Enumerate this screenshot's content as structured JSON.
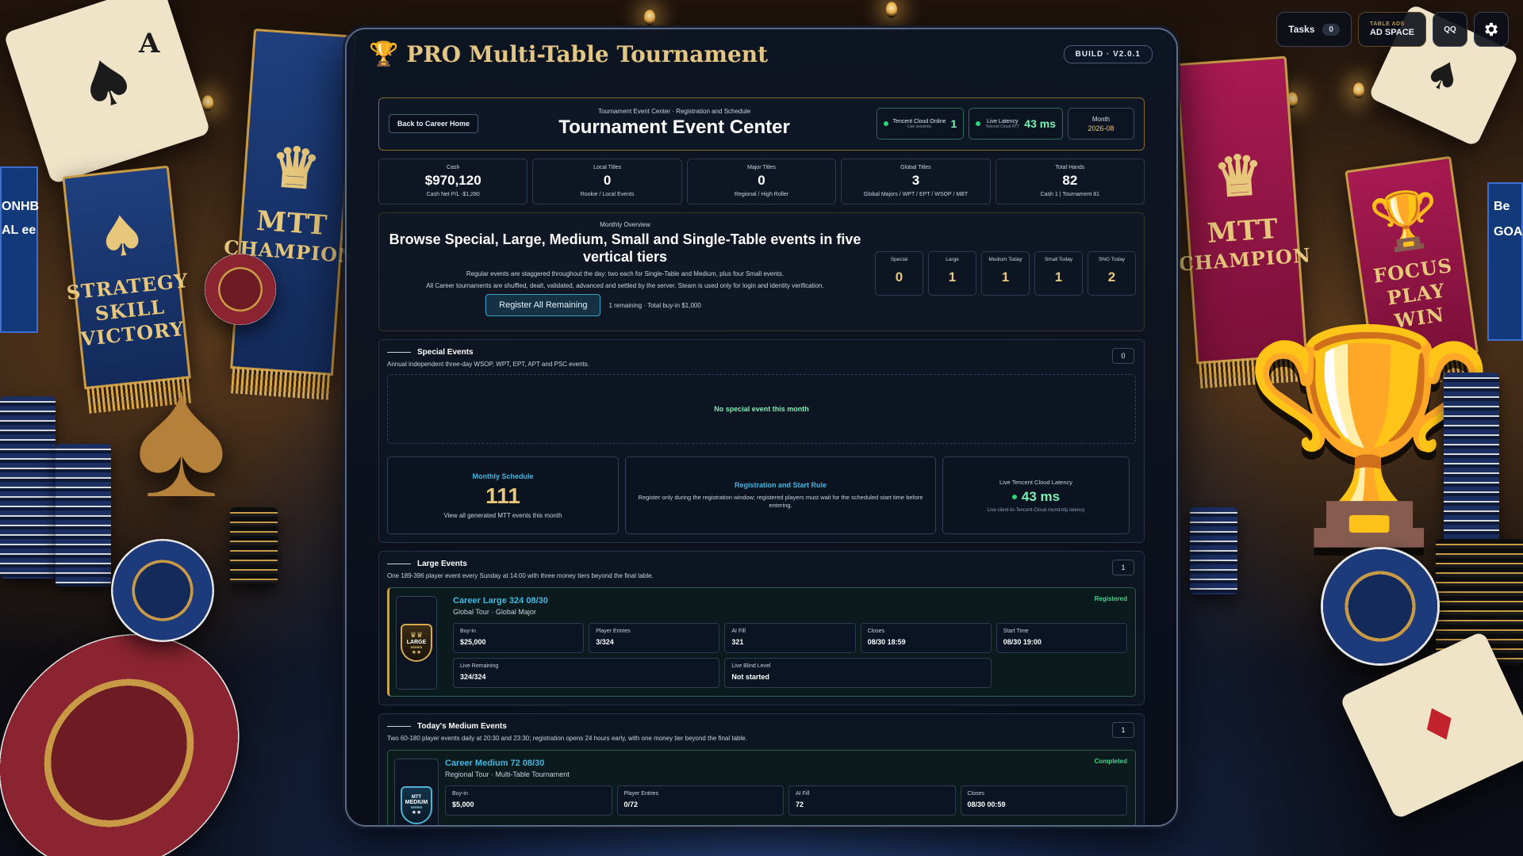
{
  "app": {
    "title": "PRO Multi-Table Tournament",
    "build": "BUILD · V2.0.1"
  },
  "topbar": {
    "tasks_label": "Tasks",
    "tasks_count": "0",
    "ads_small": "TABLE ADS",
    "ads_big": "AD SPACE",
    "qq_label": "QQ",
    "settings_icon": "gear-icon"
  },
  "backdrop": {
    "banner_left_1": [
      "STRATEGY",
      "SKILL",
      "VICTORY"
    ],
    "banner_left_2": [
      "MTT",
      "CHAMPION"
    ],
    "banner_right_1": [
      "MTT",
      "CHAMPION"
    ],
    "banner_right_2": [
      "FOCUS",
      "PLAY",
      "WIN"
    ],
    "card_left": "A",
    "far_left_sign": [
      "ONHB",
      "AL ee"
    ],
    "far_right_sign": [
      "Be",
      "GOA"
    ]
  },
  "header": {
    "back_label": "Back to Career Home",
    "kicker": "Tournament Event Center · Registration and Schedule",
    "title": "Tournament Event Center",
    "cloud_label": "Tencent Cloud Online",
    "cloud_sub": "Live sessions",
    "cloud_value": "1",
    "latency_label": "Live Latency",
    "latency_sub": "Tencent Cloud RTT",
    "latency_value": "43 ms",
    "month_label": "Month",
    "month_value": "2026-08"
  },
  "stats": [
    {
      "label": "Cash",
      "value": "$970,120",
      "sub": "Cash Net P/L -$1,280"
    },
    {
      "label": "Local Titles",
      "value": "0",
      "sub": "Rookie / Local Events"
    },
    {
      "label": "Major Titles",
      "value": "0",
      "sub": "Regional / High Roller"
    },
    {
      "label": "Global Titles",
      "value": "3",
      "sub": "Global Majors / WPT / EPT / WSOP / MBT"
    },
    {
      "label": "Total Hands",
      "value": "82",
      "sub": "Cash 1 | Tournament 81"
    }
  ],
  "overview": {
    "kicker": "Monthly Overview",
    "title": "Browse Special, Large, Medium, Small and Single-Table events in five vertical tiers",
    "line1": "Regular events are staggered throughout the day: two each for Single-Table and Medium, plus four Small events.",
    "line2": "All Career tournaments are shuffled, dealt, validated, advanced and settled by the server. Steam is used only for login and identity verification.",
    "register_label": "Register All Remaining",
    "remaining": "1 remaining · Total buy-in $1,000",
    "tiers": [
      {
        "label": "Special",
        "value": "0"
      },
      {
        "label": "Large",
        "value": "1"
      },
      {
        "label": "Medium Today",
        "value": "1"
      },
      {
        "label": "Small Today",
        "value": "1"
      },
      {
        "label": "SNG Today",
        "value": "2"
      }
    ]
  },
  "special": {
    "title": "Special Events",
    "desc": "Annual independent three-day WSOP, WPT, EPT, APT and PSC events.",
    "count": "0",
    "empty": "No special event this month",
    "schedule_title": "Monthly Schedule",
    "schedule_value": "111",
    "schedule_sub": "View all generated MTT events this month",
    "rule_title": "Registration and Start Rule",
    "rule_text": "Register only during the registration window; registered players must wait for the scheduled start time before entering.",
    "lat_title": "Live Tencent Cloud Latency",
    "lat_value": "43 ms",
    "lat_sub": "Live client-to-Tencent-Cloud round-trip latency"
  },
  "large": {
    "title": "Large Events",
    "desc": "One 189-396 player event every Sunday at 14:00 with three money tiers beyond the final table.",
    "count": "1",
    "event": {
      "badge_top": "♛♛",
      "badge": "LARGE",
      "badge_sub": "SERIES",
      "badge_stars": "★★",
      "name": "Career Large 324 08/30",
      "tour": "Global Tour · Global Major",
      "status": "Registered",
      "cells": [
        {
          "label": "Buy-in",
          "value": "$25,000"
        },
        {
          "label": "Player Entries",
          "value": "3/324"
        },
        {
          "label": "AI Fill",
          "value": "321"
        },
        {
          "label": "Closes",
          "value": "08/30 18:59"
        },
        {
          "label": "Start Time",
          "value": "08/30 19:00"
        },
        {
          "label": "Live Remaining",
          "value": "324/324"
        },
        {
          "label": "Live Blind Level",
          "value": "Not started"
        }
      ]
    }
  },
  "medium": {
    "title": "Today's Medium Events",
    "desc": "Two 60-180 player events daily at 20:30 and 23:30; registration opens 24 hours early, with one money tier beyond the final table.",
    "count": "1",
    "event": {
      "badge_top": "MTT",
      "badge": "MEDIUM",
      "badge_sub": "SERIES",
      "badge_stars": "★★",
      "name": "Career Medium 72 08/30",
      "tour": "Regional Tour · Multi-Table Tournament",
      "status": "Completed",
      "cells": [
        {
          "label": "Buy-in",
          "value": "$5,000"
        },
        {
          "label": "Player Entries",
          "value": "0/72"
        },
        {
          "label": "AI Fill",
          "value": "72"
        },
        {
          "label": "Closes",
          "value": "08/30 00:59"
        }
      ]
    }
  }
}
